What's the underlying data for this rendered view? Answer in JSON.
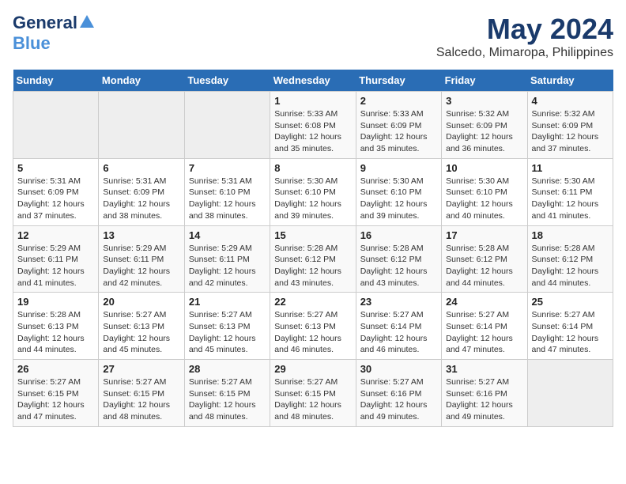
{
  "header": {
    "logo_line1": "General",
    "logo_line2": "Blue",
    "month_year": "May 2024",
    "location": "Salcedo, Mimaropa, Philippines"
  },
  "weekdays": [
    "Sunday",
    "Monday",
    "Tuesday",
    "Wednesday",
    "Thursday",
    "Friday",
    "Saturday"
  ],
  "weeks": [
    [
      {
        "num": "",
        "info": ""
      },
      {
        "num": "",
        "info": ""
      },
      {
        "num": "",
        "info": ""
      },
      {
        "num": "1",
        "info": "Sunrise: 5:33 AM\nSunset: 6:08 PM\nDaylight: 12 hours\nand 35 minutes."
      },
      {
        "num": "2",
        "info": "Sunrise: 5:33 AM\nSunset: 6:09 PM\nDaylight: 12 hours\nand 35 minutes."
      },
      {
        "num": "3",
        "info": "Sunrise: 5:32 AM\nSunset: 6:09 PM\nDaylight: 12 hours\nand 36 minutes."
      },
      {
        "num": "4",
        "info": "Sunrise: 5:32 AM\nSunset: 6:09 PM\nDaylight: 12 hours\nand 37 minutes."
      }
    ],
    [
      {
        "num": "5",
        "info": "Sunrise: 5:31 AM\nSunset: 6:09 PM\nDaylight: 12 hours\nand 37 minutes."
      },
      {
        "num": "6",
        "info": "Sunrise: 5:31 AM\nSunset: 6:09 PM\nDaylight: 12 hours\nand 38 minutes."
      },
      {
        "num": "7",
        "info": "Sunrise: 5:31 AM\nSunset: 6:10 PM\nDaylight: 12 hours\nand 38 minutes."
      },
      {
        "num": "8",
        "info": "Sunrise: 5:30 AM\nSunset: 6:10 PM\nDaylight: 12 hours\nand 39 minutes."
      },
      {
        "num": "9",
        "info": "Sunrise: 5:30 AM\nSunset: 6:10 PM\nDaylight: 12 hours\nand 39 minutes."
      },
      {
        "num": "10",
        "info": "Sunrise: 5:30 AM\nSunset: 6:10 PM\nDaylight: 12 hours\nand 40 minutes."
      },
      {
        "num": "11",
        "info": "Sunrise: 5:30 AM\nSunset: 6:11 PM\nDaylight: 12 hours\nand 41 minutes."
      }
    ],
    [
      {
        "num": "12",
        "info": "Sunrise: 5:29 AM\nSunset: 6:11 PM\nDaylight: 12 hours\nand 41 minutes."
      },
      {
        "num": "13",
        "info": "Sunrise: 5:29 AM\nSunset: 6:11 PM\nDaylight: 12 hours\nand 42 minutes."
      },
      {
        "num": "14",
        "info": "Sunrise: 5:29 AM\nSunset: 6:11 PM\nDaylight: 12 hours\nand 42 minutes."
      },
      {
        "num": "15",
        "info": "Sunrise: 5:28 AM\nSunset: 6:12 PM\nDaylight: 12 hours\nand 43 minutes."
      },
      {
        "num": "16",
        "info": "Sunrise: 5:28 AM\nSunset: 6:12 PM\nDaylight: 12 hours\nand 43 minutes."
      },
      {
        "num": "17",
        "info": "Sunrise: 5:28 AM\nSunset: 6:12 PM\nDaylight: 12 hours\nand 44 minutes."
      },
      {
        "num": "18",
        "info": "Sunrise: 5:28 AM\nSunset: 6:12 PM\nDaylight: 12 hours\nand 44 minutes."
      }
    ],
    [
      {
        "num": "19",
        "info": "Sunrise: 5:28 AM\nSunset: 6:13 PM\nDaylight: 12 hours\nand 44 minutes."
      },
      {
        "num": "20",
        "info": "Sunrise: 5:27 AM\nSunset: 6:13 PM\nDaylight: 12 hours\nand 45 minutes."
      },
      {
        "num": "21",
        "info": "Sunrise: 5:27 AM\nSunset: 6:13 PM\nDaylight: 12 hours\nand 45 minutes."
      },
      {
        "num": "22",
        "info": "Sunrise: 5:27 AM\nSunset: 6:13 PM\nDaylight: 12 hours\nand 46 minutes."
      },
      {
        "num": "23",
        "info": "Sunrise: 5:27 AM\nSunset: 6:14 PM\nDaylight: 12 hours\nand 46 minutes."
      },
      {
        "num": "24",
        "info": "Sunrise: 5:27 AM\nSunset: 6:14 PM\nDaylight: 12 hours\nand 47 minutes."
      },
      {
        "num": "25",
        "info": "Sunrise: 5:27 AM\nSunset: 6:14 PM\nDaylight: 12 hours\nand 47 minutes."
      }
    ],
    [
      {
        "num": "26",
        "info": "Sunrise: 5:27 AM\nSunset: 6:15 PM\nDaylight: 12 hours\nand 47 minutes."
      },
      {
        "num": "27",
        "info": "Sunrise: 5:27 AM\nSunset: 6:15 PM\nDaylight: 12 hours\nand 48 minutes."
      },
      {
        "num": "28",
        "info": "Sunrise: 5:27 AM\nSunset: 6:15 PM\nDaylight: 12 hours\nand 48 minutes."
      },
      {
        "num": "29",
        "info": "Sunrise: 5:27 AM\nSunset: 6:15 PM\nDaylight: 12 hours\nand 48 minutes."
      },
      {
        "num": "30",
        "info": "Sunrise: 5:27 AM\nSunset: 6:16 PM\nDaylight: 12 hours\nand 49 minutes."
      },
      {
        "num": "31",
        "info": "Sunrise: 5:27 AM\nSunset: 6:16 PM\nDaylight: 12 hours\nand 49 minutes."
      },
      {
        "num": "",
        "info": ""
      }
    ]
  ]
}
